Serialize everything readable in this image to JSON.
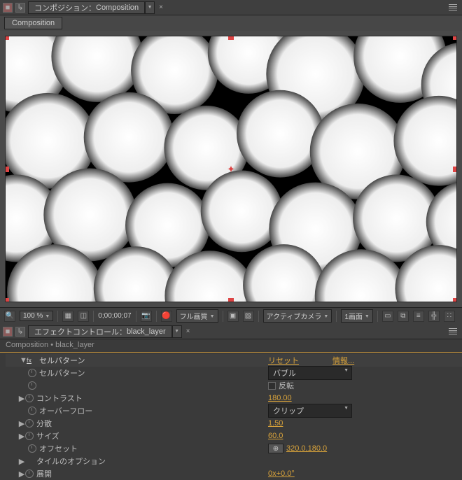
{
  "comp_panel": {
    "tab_prefix": "コンポジション：",
    "tab_name": "Composition",
    "sub_tab": "Composition"
  },
  "toolbar": {
    "zoom": "100 %",
    "timecode": "0;00;00;07",
    "resolution": "フル画質",
    "camera": "アクティブカメラ",
    "views": "1画面"
  },
  "effects_panel": {
    "tab_prefix": "エフェクトコントロール：",
    "tab_name": "black_layer",
    "breadcrumb_comp": "Composition",
    "breadcrumb_layer": "black_layer"
  },
  "effect": {
    "name": "セルパターン",
    "reset": "リセット",
    "info": "情報...",
    "params": {
      "pattern": {
        "label": "セルパターン",
        "value": "バブル"
      },
      "invert": {
        "label": "反転"
      },
      "contrast": {
        "label": "コントラスト",
        "value": "180.00"
      },
      "overflow": {
        "label": "オーバーフロー",
        "value": "クリップ"
      },
      "dispersion": {
        "label": "分散",
        "value": "1.50"
      },
      "size": {
        "label": "サイズ",
        "value": "60.0"
      },
      "offset": {
        "label": "オフセット",
        "value": "320.0,180.0"
      },
      "tile": {
        "label": "タイルのオプション"
      },
      "evolution": {
        "label": "展開",
        "value": "0x+0.0°"
      }
    }
  }
}
